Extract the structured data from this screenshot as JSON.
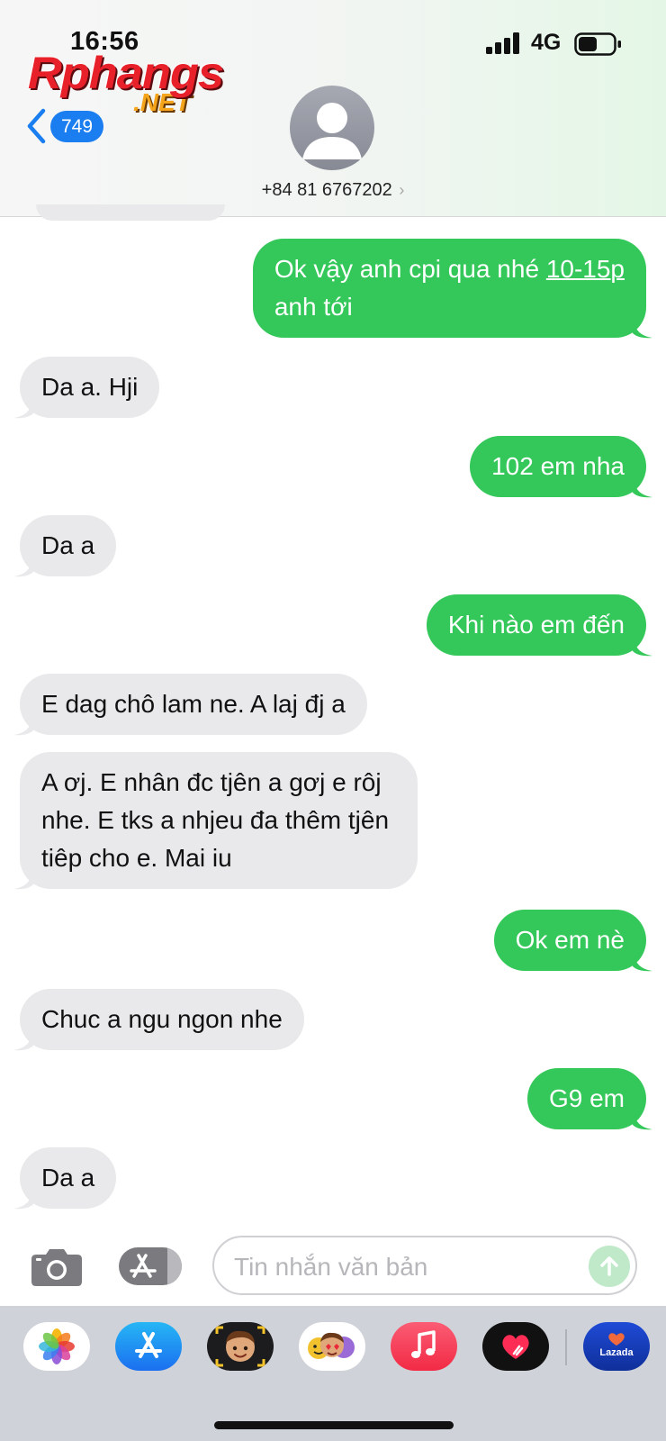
{
  "status_bar": {
    "time": "16:56",
    "network": "4G",
    "signal_bars": 4,
    "battery_level": 0.55
  },
  "watermark": {
    "main": "Rphangs",
    "sub": ".NET"
  },
  "header": {
    "back_count": "749",
    "contact": "+84 81 6767202",
    "chevron": "›",
    "accent_color": "#1a7df0"
  },
  "messages": [
    {
      "id": 1,
      "direction": "outgoing",
      "lines": [
        "Ok vậy anh cpi qua nhé ",
        "anh tới"
      ],
      "link": "10-15p"
    },
    {
      "id": 2,
      "direction": "incoming",
      "text": "Da a. Hji"
    },
    {
      "id": 3,
      "direction": "outgoing",
      "text": "102 em nha"
    },
    {
      "id": 4,
      "direction": "incoming",
      "text": "Da a"
    },
    {
      "id": 5,
      "direction": "outgoing",
      "text": "Khi nào em đến"
    },
    {
      "id": 6,
      "direction": "incoming",
      "text": "E dag chô lam ne. A laj đj a"
    },
    {
      "id": 7,
      "direction": "incoming",
      "lines": [
        "A ơj. E nhân đc tjên a gơj e rôj",
        "nhe. E tks a nhjeu đa thêm tjên",
        "tiêp cho e. Mai iu"
      ]
    },
    {
      "id": 8,
      "direction": "outgoing",
      "text": "Ok em nè"
    },
    {
      "id": 9,
      "direction": "incoming",
      "text": "Chuc a ngu ngon nhe"
    },
    {
      "id": 10,
      "direction": "outgoing",
      "text": "G9 em"
    },
    {
      "id": 11,
      "direction": "incoming",
      "text": "Da a"
    }
  ],
  "colors": {
    "outgoing_bubble": "#34c759",
    "incoming_bubble": "#e9e9eb"
  },
  "compose": {
    "placeholder": "Tin nhắn văn bản",
    "value": ""
  },
  "app_drawer": [
    {
      "name": "photos-app",
      "icon": "photos-icon"
    },
    {
      "name": "app-store-app",
      "icon": "app-store-icon"
    },
    {
      "name": "memoji-app",
      "icon": "memoji-icon"
    },
    {
      "name": "animoji-stickers-app",
      "icon": "animoji-stickers-icon"
    },
    {
      "name": "music-app",
      "icon": "music-icon"
    },
    {
      "name": "digital-touch-app",
      "icon": "heart-touch-icon"
    },
    {
      "name": "lazada-app",
      "icon": "lazada-icon",
      "label": "Lazada"
    }
  ]
}
